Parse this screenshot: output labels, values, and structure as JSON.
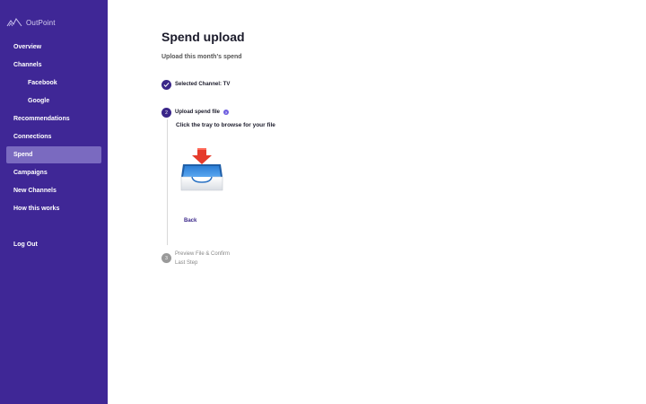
{
  "app": {
    "logo_text": "OutPoint"
  },
  "sidebar": {
    "items": [
      {
        "label": "Overview"
      },
      {
        "label": "Channels"
      },
      {
        "label": "Facebook"
      },
      {
        "label": "Google"
      },
      {
        "label": "Recommendations"
      },
      {
        "label": "Connections"
      },
      {
        "label": "Spend"
      },
      {
        "label": "Campaigns"
      },
      {
        "label": "New Channels"
      },
      {
        "label": "How this works"
      },
      {
        "label": "Log Out"
      }
    ],
    "active": "Spend"
  },
  "main": {
    "title": "Spend upload",
    "subtitle": "Upload this month's spend",
    "steps": [
      {
        "number": "1",
        "label": "Selected Channel: TV",
        "status": "done"
      },
      {
        "number": "2",
        "label": "Upload spend file",
        "status": "current",
        "help_icon": "question-icon"
      },
      {
        "number": "3",
        "label": "Preview File & Confirm",
        "sublabel": "Last Step",
        "status": "pending"
      }
    ],
    "instruction": "Click the tray to browse for your file",
    "tray_icon": "inbox-tray-download-icon",
    "back_label": "Back"
  },
  "colors": {
    "sidebar_bg": "#3f2796",
    "active_item": "#7a6ac0",
    "accent": "#3a2689",
    "help": "#6f5fe0"
  }
}
